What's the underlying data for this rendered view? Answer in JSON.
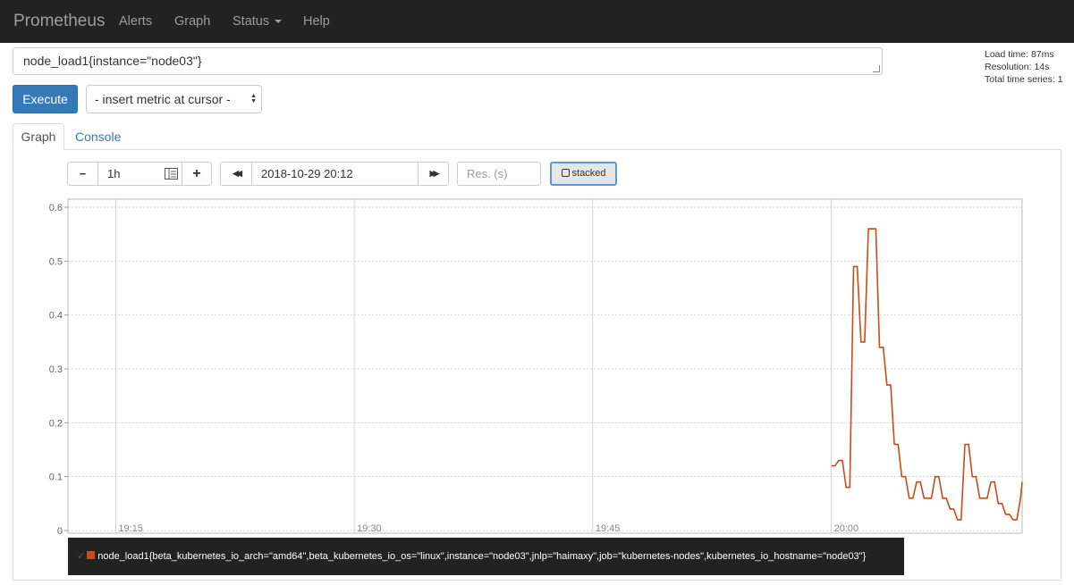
{
  "nav": {
    "brand": "Prometheus",
    "items": [
      {
        "label": "Alerts"
      },
      {
        "label": "Graph"
      },
      {
        "label": "Status"
      },
      {
        "label": "Help"
      }
    ]
  },
  "query": {
    "expression": "node_load1{instance=\"node03\"}"
  },
  "stats": {
    "load_time": "Load time: 87ms",
    "resolution": "Resolution: 14s",
    "total_series": "Total time series: 1"
  },
  "actions": {
    "execute_label": "Execute",
    "metric_select": "- insert metric at cursor -"
  },
  "tabs": {
    "graph": "Graph",
    "console": "Console"
  },
  "controls": {
    "minus": "−",
    "range": "1h",
    "plus": "+",
    "back": "◀◀",
    "end_time": "2018-10-29 20:12",
    "forward": "▶▶",
    "resolution_placeholder": "Res. (s)",
    "stacked_label": "stacked"
  },
  "colors": {
    "series": "#cb4b16",
    "navbar": "#222222",
    "accent": "#337ab7"
  },
  "chart_data": {
    "type": "line",
    "x_tick_labels": [
      "19:15",
      "19:30",
      "19:45",
      "20:00"
    ],
    "y_tick_labels": [
      "0",
      "0.1",
      "0.2",
      "0.3",
      "0.4",
      "0.5",
      "0.6"
    ],
    "xlim": [
      "19:12",
      "20:12"
    ],
    "ylim": [
      -0.005,
      0.615
    ],
    "grid": true,
    "series": [
      {
        "name": "node_load1{beta_kubernetes_io_arch=\"amd64\",beta_kubernetes_io_os=\"linux\",instance=\"node03\",jnlp=\"haimaxy\",job=\"kubernetes-nodes\",kubernetes_io_hostname=\"node03\"}",
        "x": [
          "20:00:00",
          "20:00:14",
          "20:00:28",
          "20:00:42",
          "20:00:56",
          "20:01:10",
          "20:01:24",
          "20:01:38",
          "20:01:52",
          "20:02:06",
          "20:02:20",
          "20:02:34",
          "20:02:48",
          "20:03:02",
          "20:03:16",
          "20:03:30",
          "20:03:44",
          "20:03:58",
          "20:04:12",
          "20:04:26",
          "20:04:40",
          "20:04:54",
          "20:05:08",
          "20:05:22",
          "20:05:36",
          "20:05:50",
          "20:06:04",
          "20:06:18",
          "20:06:32",
          "20:06:46",
          "20:07:00",
          "20:07:14",
          "20:07:28",
          "20:07:42",
          "20:07:56",
          "20:08:10",
          "20:08:24",
          "20:08:38",
          "20:08:52",
          "20:09:06",
          "20:09:20",
          "20:09:34",
          "20:09:48",
          "20:10:02",
          "20:10:16",
          "20:10:30",
          "20:10:44",
          "20:10:58",
          "20:11:12",
          "20:11:26",
          "20:11:40",
          "20:11:54",
          "20:12:00"
        ],
        "y": [
          0.12,
          0.12,
          0.13,
          0.13,
          0.08,
          0.08,
          0.49,
          0.49,
          0.35,
          0.35,
          0.56,
          0.56,
          0.56,
          0.34,
          0.34,
          0.27,
          0.27,
          0.16,
          0.16,
          0.1,
          0.1,
          0.06,
          0.06,
          0.09,
          0.09,
          0.06,
          0.06,
          0.06,
          0.1,
          0.1,
          0.06,
          0.06,
          0.04,
          0.04,
          0.02,
          0.02,
          0.16,
          0.16,
          0.1,
          0.1,
          0.06,
          0.06,
          0.06,
          0.09,
          0.09,
          0.05,
          0.05,
          0.03,
          0.03,
          0.02,
          0.02,
          0.06,
          0.09
        ]
      }
    ]
  }
}
